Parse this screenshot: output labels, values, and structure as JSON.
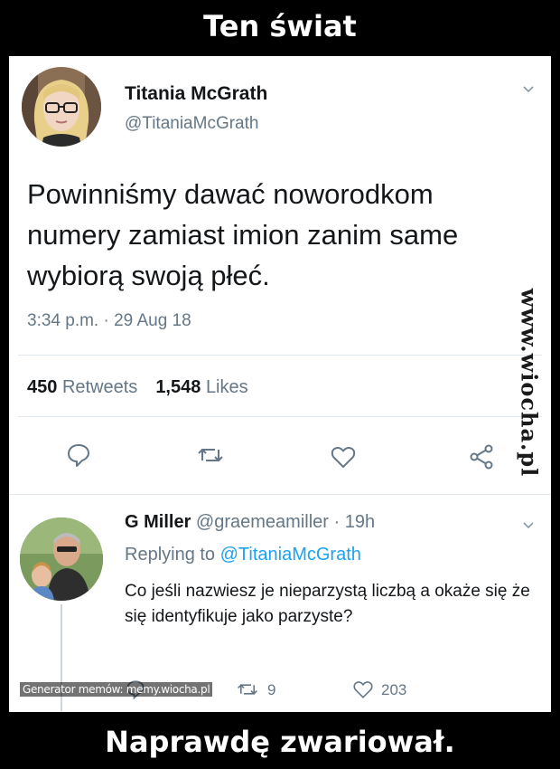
{
  "meme": {
    "top_caption": "Ten świat",
    "bottom_caption": "Naprawdę zwariował."
  },
  "tweet": {
    "display_name": "Titania McGrath",
    "handle": "@TitaniaMcGrath",
    "text": "Powinniśmy dawać noworodkom numery zamiast imion zanim same wybiorą swoją płeć.",
    "timestamp": "3:34 p.m. · 29 Aug 18",
    "retweets_count": "450",
    "retweets_label": "Retweets",
    "likes_count": "1,548",
    "likes_label": "Likes",
    "actions": [
      "reply-icon",
      "retweet-icon",
      "heart-icon",
      "share-icon"
    ]
  },
  "reply": {
    "display_name": "G Miller",
    "handle_time": "@graemeamiller · 19h",
    "replying_prefix": "Replying to",
    "replying_handle": "@TitaniaMcGrath",
    "text": "Co jeśli nazwiesz je nieparzystą liczbą a okaże się że się identyfikuje jako parzyste?",
    "retweets": "9",
    "likes": "203"
  },
  "watermarks": {
    "side": "www.wiocha.pl",
    "generator": "Generator memów: memy.wiocha.pl"
  },
  "colors": {
    "text_primary": "#14171a",
    "text_secondary": "#657786",
    "link": "#1da1f2",
    "divider": "#e1e8ed"
  }
}
